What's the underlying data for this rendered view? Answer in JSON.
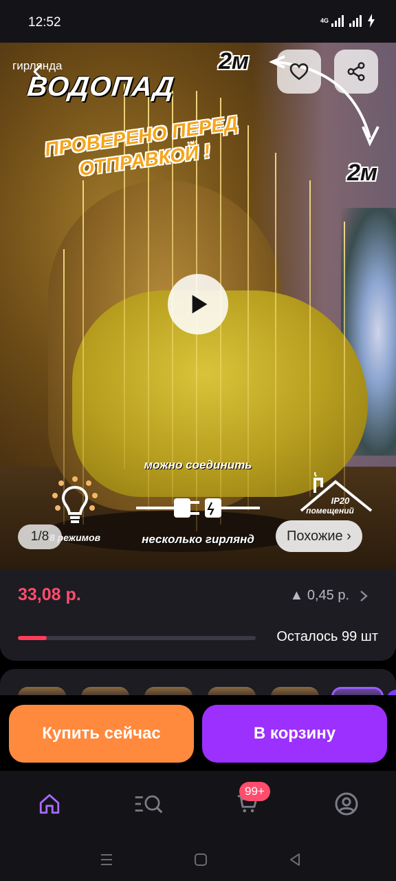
{
  "status_bar": {
    "time": "12:52",
    "network": "4G"
  },
  "hero": {
    "brand_sub": "гирлянда",
    "brand_title": "ВОДОПАД",
    "promo_line1": "ПРОВЕРЕНО ПЕРЕД",
    "promo_line2": "ОТПРАВКОЙ !",
    "dim_top": "2м",
    "dim_side": "2м",
    "feature_modes": "8 режимов",
    "feature_connect_top": "можно соединить",
    "feature_connect_bottom": "несколько гирлянд",
    "feature_ip_code": "IP20",
    "feature_ip_room": "помещений",
    "counter": "1/8",
    "similar_label": "Похожие ›"
  },
  "product": {
    "price": "33,08 р.",
    "price_delta": "▲ 0,45 р.",
    "stock_text": "Осталось 99 шт",
    "stock_fill_fraction": 0.12
  },
  "actions": {
    "buy_now": "Купить сейчас",
    "add_to_cart": "В корзину"
  },
  "nav": {
    "cart_badge": "99+",
    "items": [
      "home",
      "catalog-search",
      "cart",
      "profile"
    ]
  },
  "colors": {
    "price": "#ff4d6d",
    "buy": "#ff8a3d",
    "cart": "#9b30ff",
    "accent": "#9b5cff",
    "stock_bar": "#ff3d5a"
  }
}
